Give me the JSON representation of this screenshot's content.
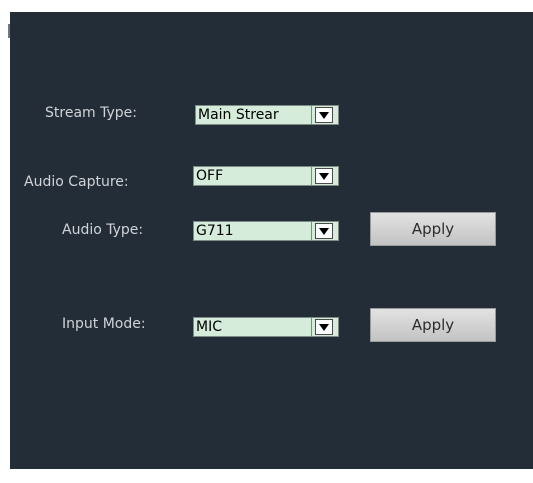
{
  "form": {
    "stream_type": {
      "label": "Stream Type:",
      "value": "Main Strear"
    },
    "audio_capture": {
      "label": "Audio Capture:",
      "value": "OFF"
    },
    "audio_type": {
      "label": "Audio Type:",
      "value": "G711",
      "apply_label": "Apply"
    },
    "input_mode": {
      "label": "Input Mode:",
      "value": "MIC",
      "apply_label": "Apply"
    }
  },
  "icons": {
    "dropdown": "chevron-down-icon"
  },
  "colors": {
    "panel_bg": "#232d37",
    "label_text": "#cfd3d7",
    "select_bg": "#d4ecd9",
    "button_bg": "#d2d2d2"
  }
}
